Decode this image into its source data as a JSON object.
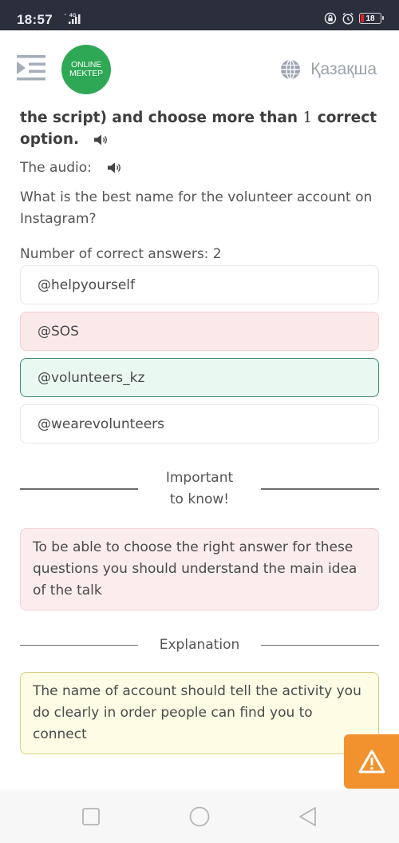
{
  "status_bar": {
    "time": "18:57",
    "network": "4G",
    "battery_level": "18",
    "icons": [
      "signal-icon",
      "rotation-lock-icon",
      "alarm-icon",
      "battery-icon"
    ]
  },
  "header": {
    "menu_icon": "menu-indent-icon",
    "logo_line1": "ONLINE",
    "logo_line2": "MEKTEP",
    "language_icon": "globe-icon",
    "language_label": "Қазақша"
  },
  "task": {
    "instruction_prefix": "the script) and choose more than ",
    "instruction_number": "1",
    "instruction_suffix": " correct option.",
    "audio_label": "The audio:",
    "question": "What is the best name for the volunteer account on Instagram?",
    "num_correct_label": "Number of correct answers: 2",
    "options": [
      {
        "label": "@helpyourself",
        "state": "neutral"
      },
      {
        "label": "@SOS",
        "state": "wrong"
      },
      {
        "label": "@volunteers_kz",
        "state": "correct"
      },
      {
        "label": "@wearevolunteers",
        "state": "neutral"
      }
    ]
  },
  "important": {
    "heading": "Important to know!",
    "text": "To be able to choose the right answer for these questions you should understand the main idea of the talk"
  },
  "explanation": {
    "heading": "Explanation",
    "text": "The name of account should tell the activity you do clearly in order people can find you to connect"
  },
  "colors": {
    "brand_green": "#2ea855",
    "wrong_bg": "#fbe9ea",
    "correct_bg": "#eaf8f2",
    "correct_border": "#3f8a72",
    "explanation_bg": "#fdfde6",
    "report_orange": "#f2922e",
    "status_bar_bg": "#2b2f3c"
  },
  "report_button": {
    "icon": "warning-icon"
  },
  "nav_bar": {
    "buttons": [
      "recents-button",
      "home-button",
      "back-button"
    ]
  }
}
